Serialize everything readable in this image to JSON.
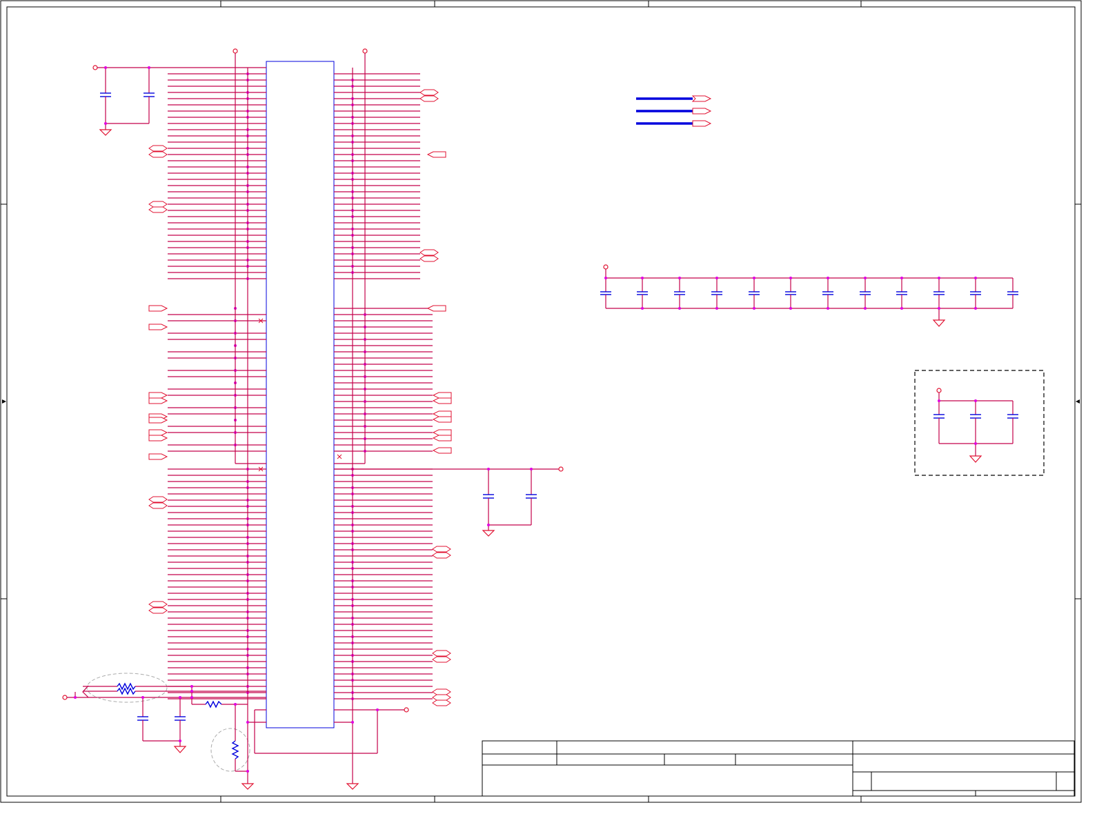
{
  "sheet": {
    "title_block_fields": [
      "",
      "",
      "",
      "",
      "",
      "",
      ""
    ]
  },
  "colors": {
    "wire": "#c4004a",
    "component": "#0000dd",
    "port": "#e01030",
    "junction": "#e000e0",
    "frame": "#000000"
  },
  "icons": [
    "ground-symbol",
    "power-symbol",
    "capacitor-symbol",
    "resistor-symbol",
    "no-connect-marker"
  ]
}
